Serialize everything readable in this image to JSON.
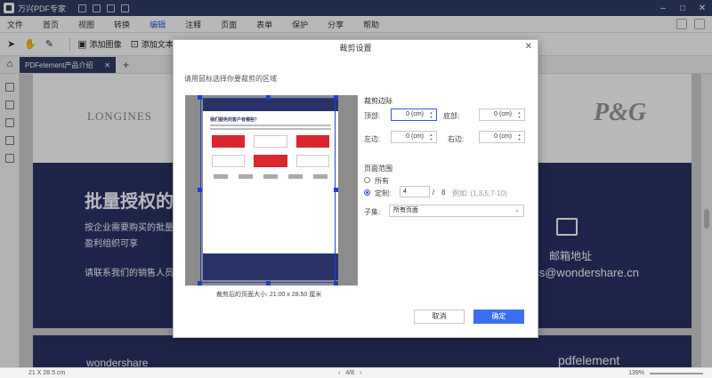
{
  "titlebar": {
    "app_title": "万兴PDF专家",
    "controls": [
      "–",
      "□",
      "✕"
    ]
  },
  "menu": {
    "items": [
      "文件",
      "首页",
      "视图",
      "转换",
      "编辑",
      "注释",
      "页面",
      "表单",
      "保护",
      "分享",
      "帮助"
    ],
    "active_index": 4
  },
  "toolbar": {
    "add_image": "添加图像",
    "add_text": "添加文本"
  },
  "tabs": {
    "doc_tab": "PDFelement产品介绍",
    "close": "✕",
    "add": "+"
  },
  "document": {
    "brand_left": "LONGINES",
    "brand_right": "P&G",
    "heading": "批量授权的",
    "para1": "按企业需要购买的批量教育与非盈利组织可享",
    "para2": "请联系我们的销售人员",
    "mail_title": "邮箱地址",
    "mail_addr": "ess@wondershare.cn",
    "footer_left": "wondershare",
    "footer_right": "pdfelement"
  },
  "statusbar": {
    "page_size": "21 X 28.5 cm",
    "page_indicator": "4/8",
    "zoom": "139%"
  },
  "dialog": {
    "title": "裁剪设置",
    "close": "✕",
    "hint": "请用鼠标选择你要裁剪的区域",
    "preview_caption": "裁剪后的页面大小: 21.00 x 28.50 厘米",
    "thumbnail_title": "我们服务的客户有哪些？",
    "margins": {
      "title": "裁剪边际",
      "top_label": "顶部:",
      "top_value": "0 (cm)",
      "bottom_label": "底部:",
      "bottom_value": "0 (cm)",
      "left_label": "左边:",
      "left_value": "0 (cm)",
      "right_label": "右边:",
      "right_value": "0 (cm)"
    },
    "range": {
      "title": "页面范围",
      "all_label": "所有",
      "custom_label": "定制:",
      "custom_from": "4",
      "separator": "/",
      "custom_total": "8",
      "example": "例如: (1,3,5,7-10)",
      "subset_label": "子集:",
      "subset_value": "所有页面"
    },
    "cancel": "取消",
    "ok": "确定"
  },
  "colors": {
    "title_bar": "#2f3d61",
    "accent": "#3b6ef2",
    "doc_band": "#2a3366",
    "thumb_red": "#d9262f"
  }
}
